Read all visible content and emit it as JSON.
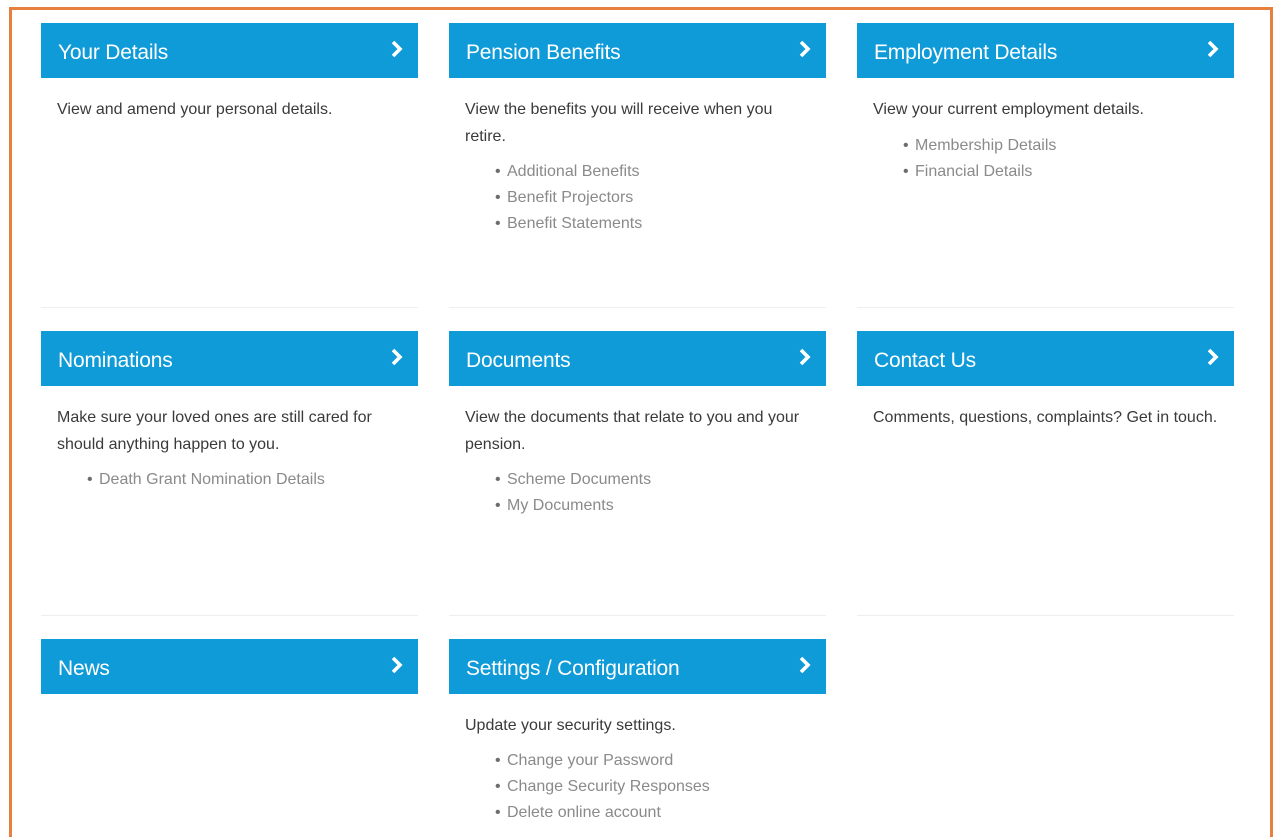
{
  "colors": {
    "frame_border": "#e5803e",
    "tile_header_bg": "#0f9ad8",
    "tile_header_text": "#ffffff",
    "body_text": "#3a3a3a",
    "link_text": "#8a8a8a"
  },
  "tiles": [
    {
      "title": "Your Details",
      "icon": "chevron-right-icon",
      "description": "View and amend your personal details.",
      "links": []
    },
    {
      "title": "Pension Benefits",
      "icon": "chevron-right-icon",
      "description": "View the benefits you will receive when you retire.",
      "links": [
        "Additional Benefits",
        "Benefit Projectors",
        "Benefit Statements"
      ]
    },
    {
      "title": "Employment Details",
      "icon": "chevron-right-icon",
      "description": "View your current employment details.",
      "links": [
        "Membership Details",
        "Financial Details"
      ]
    },
    {
      "title": "Nominations",
      "icon": "chevron-right-icon",
      "description": "Make sure your loved ones are still cared for should anything happen to you.",
      "links": [
        "Death Grant Nomination Details"
      ]
    },
    {
      "title": "Documents",
      "icon": "chevron-right-icon",
      "description": "View the documents that relate to you and your pension.",
      "links": [
        "Scheme Documents",
        "My Documents"
      ]
    },
    {
      "title": "Contact Us",
      "icon": "chevron-right-icon",
      "description": "Comments, questions, complaints? Get in touch.",
      "links": []
    },
    {
      "title": "News",
      "icon": "chevron-right-icon",
      "description": "",
      "links": []
    },
    {
      "title": "Settings / Configuration",
      "icon": "chevron-right-icon",
      "description": "Update your security settings.",
      "links": [
        "Change your Password",
        "Change Security Responses",
        "Delete online account"
      ]
    }
  ]
}
